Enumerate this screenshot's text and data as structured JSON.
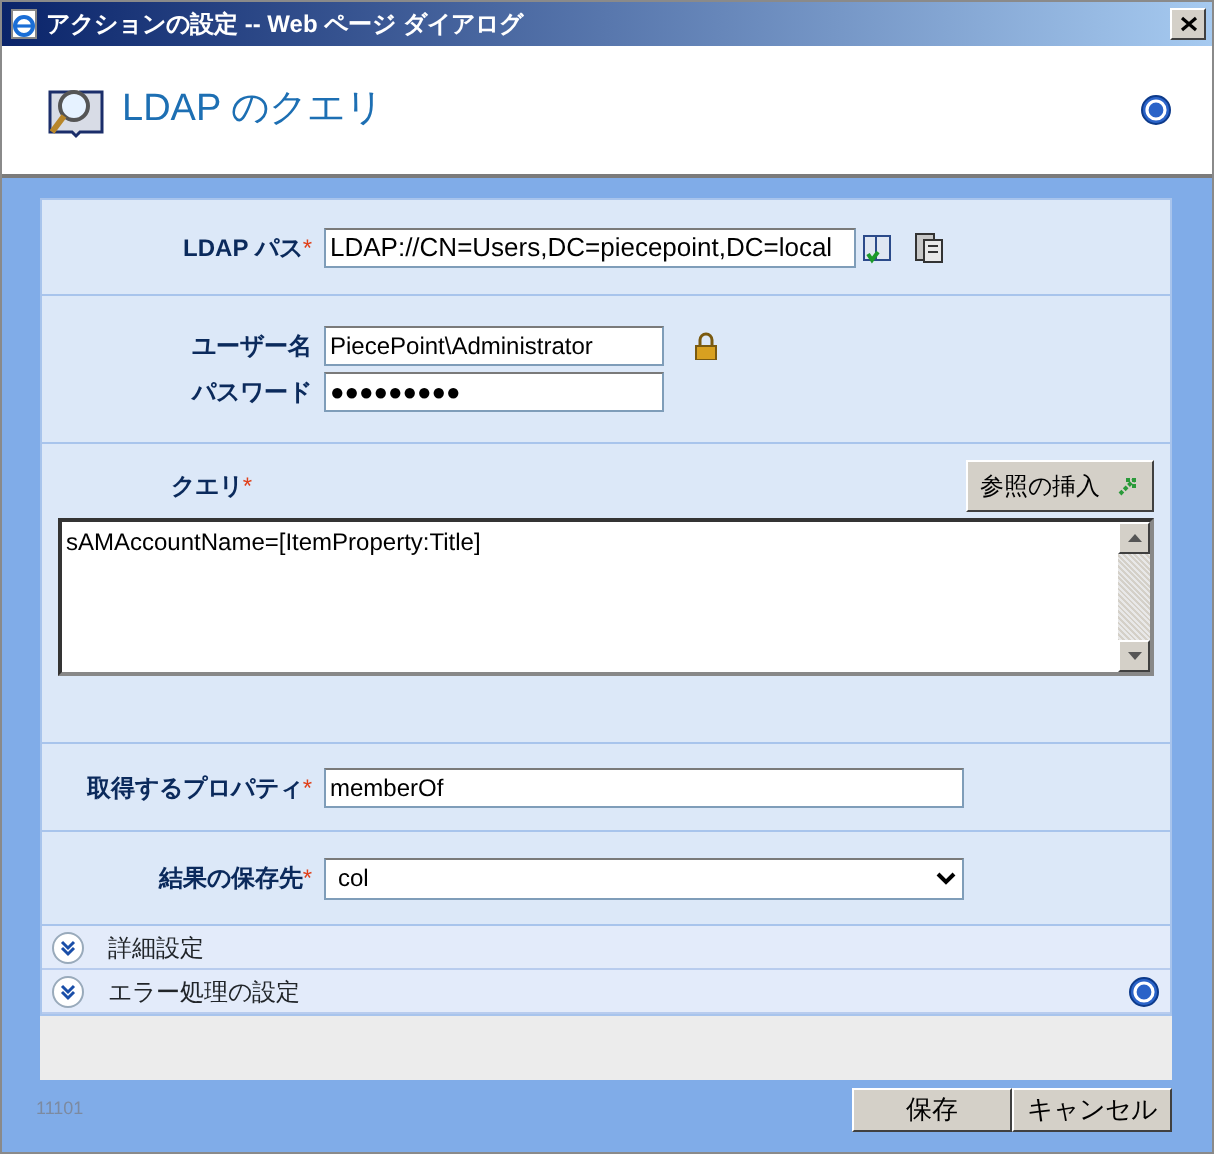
{
  "window": {
    "title": "アクションの設定 -- Web ページ ダイアログ"
  },
  "header": {
    "title": "LDAP のクエリ"
  },
  "ldap_path": {
    "label": "LDAP パス",
    "required_mark": "*",
    "value": "LDAP://CN=Users,DC=piecepoint,DC=local"
  },
  "credentials": [
    {
      "label": "ユーザー名",
      "value": "PiecePoint\\Administrator"
    },
    {
      "label": "パスワード",
      "value": "●●●●●●●●●"
    }
  ],
  "query": {
    "label": "クエリ",
    "required_mark": "*",
    "insert_button": "参照の挿入",
    "value": "sAMAccountName=[ItemProperty:Title]"
  },
  "property": {
    "label": "取得するプロパティ",
    "required_mark": "*",
    "value": "memberOf"
  },
  "result": {
    "label": "結果の保存先",
    "required_mark": "*",
    "value": "col"
  },
  "expanders": [
    {
      "label": "詳細設定",
      "expanded": false,
      "help": false
    },
    {
      "label": "エラー処理の設定",
      "expanded": false,
      "help": true
    }
  ],
  "footer": {
    "code": "11101",
    "buttons": [
      "保存",
      "キャンセル"
    ]
  }
}
